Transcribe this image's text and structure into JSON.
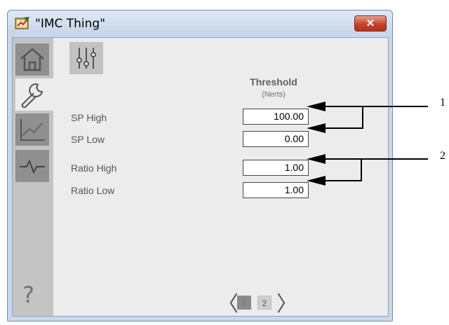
{
  "window": {
    "title": "\"IMC Thing\"",
    "close_glyph": "✕"
  },
  "nav": {
    "items": [
      {
        "name": "home-icon"
      },
      {
        "name": "wrench-icon"
      },
      {
        "name": "trend-icon"
      },
      {
        "name": "alarm-pulse-icon"
      }
    ],
    "help_glyph": "?"
  },
  "table": {
    "column_header": "Threshold",
    "column_units": "(Nerts)",
    "rows": [
      {
        "label": "SP High",
        "value": "100.00"
      },
      {
        "label": "SP Low",
        "value": "0.00"
      },
      {
        "label": "Ratio High",
        "value": "1.00"
      },
      {
        "label": "Ratio Low",
        "value": "1.00"
      }
    ]
  },
  "pager": {
    "prev": "〈",
    "next": "〉",
    "pages": [
      "1",
      "2"
    ],
    "current": "1"
  },
  "callouts": [
    "1",
    "2"
  ],
  "colors": {
    "close_button": "#c6422b",
    "nav_bg": "#c4c4c4",
    "panel_bg": "#ececec"
  }
}
